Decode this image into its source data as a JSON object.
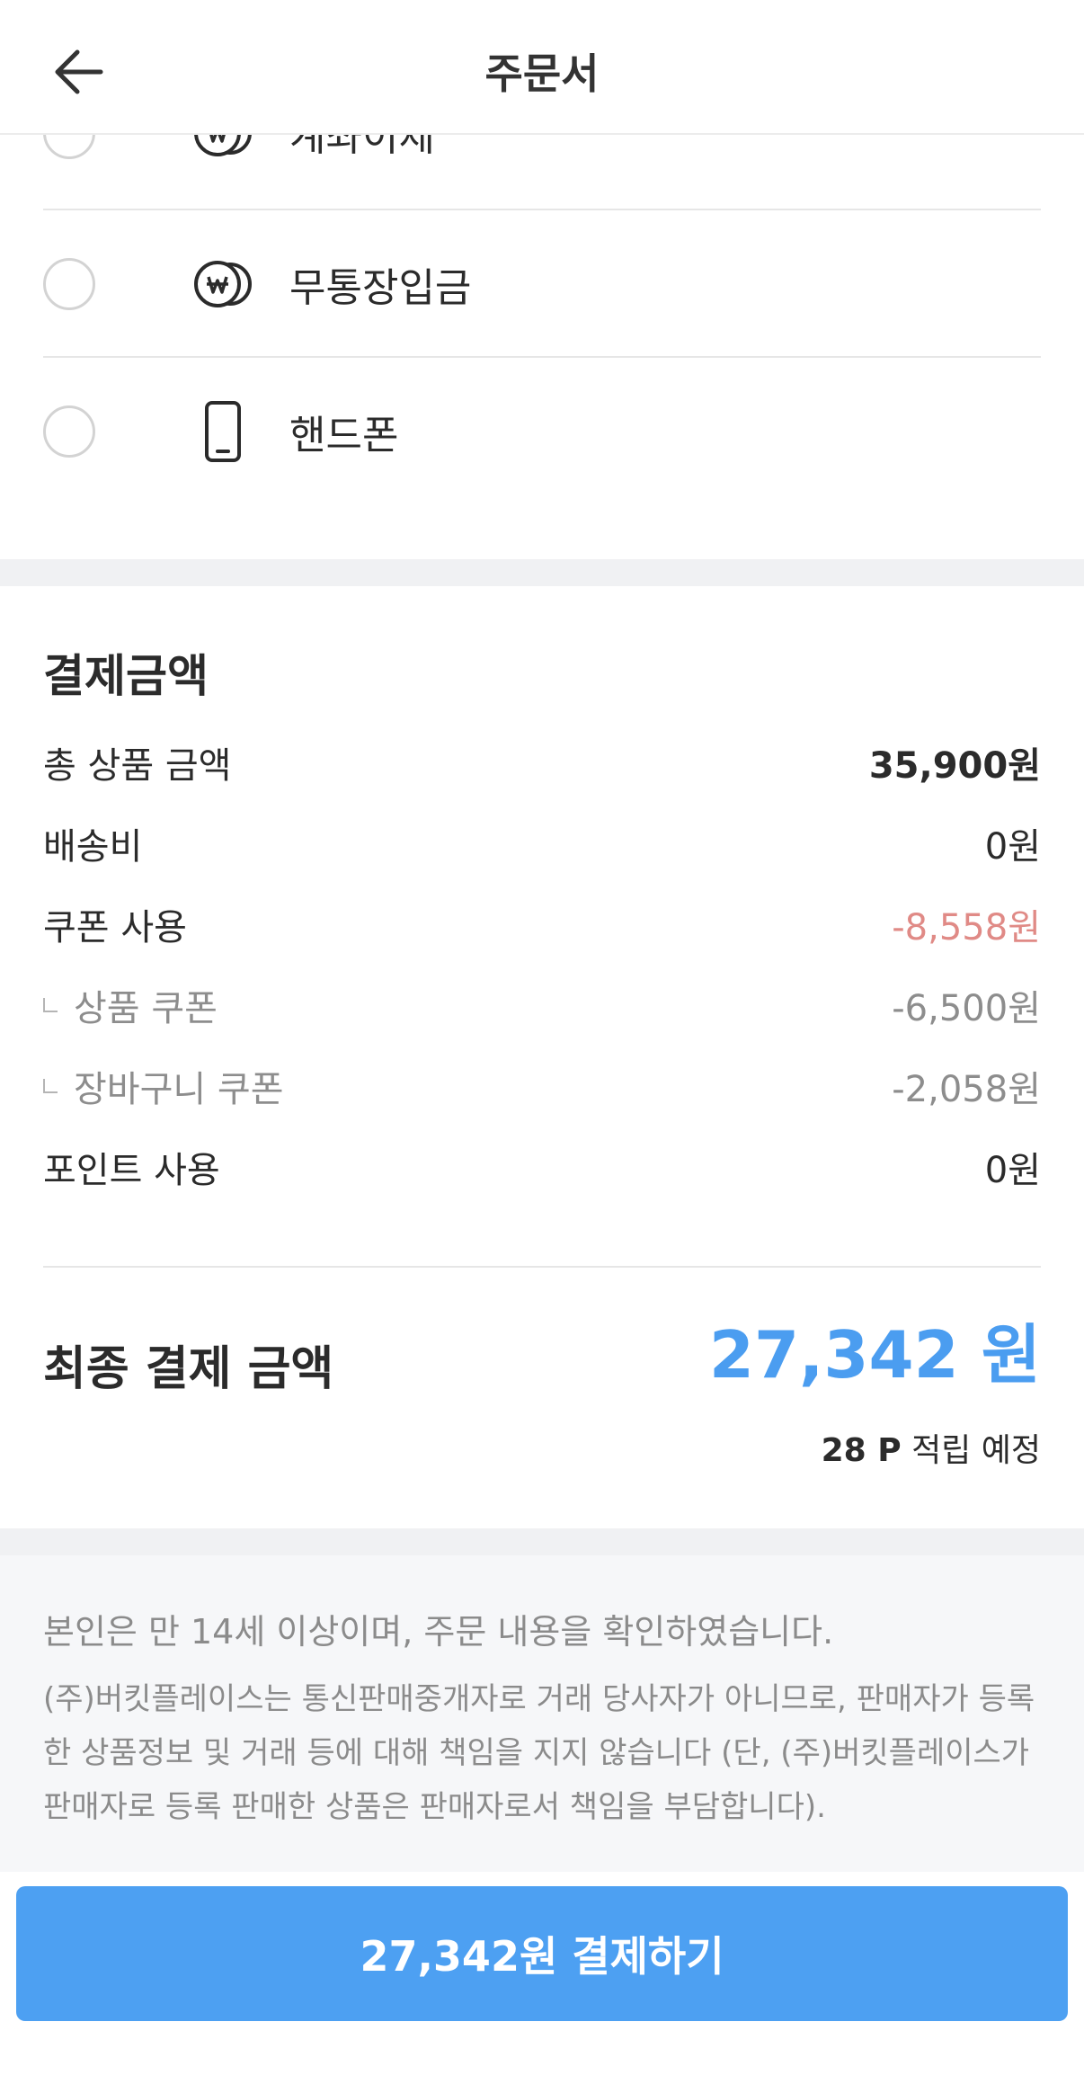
{
  "header": {
    "title": "주문서"
  },
  "payment_options": [
    {
      "label": "계좌이체",
      "icon": "won-coin-icon"
    },
    {
      "label": "무통장입금",
      "icon": "won-coin-icon"
    },
    {
      "label": "핸드폰",
      "icon": "smartphone-icon"
    }
  ],
  "amount": {
    "title": "결제금액",
    "rows": [
      {
        "label": "총 상품 금액",
        "value": "35,900원"
      },
      {
        "label": "배송비",
        "value": "0원"
      },
      {
        "label": "쿠폰 사용",
        "value": "-8,558원"
      },
      {
        "label": "상품 쿠폰",
        "value": "-6,500원"
      },
      {
        "label": "장바구니 쿠폰",
        "value": "-2,058원"
      },
      {
        "label": "포인트 사용",
        "value": "0원"
      }
    ],
    "final_label": "최종 결제 금액",
    "final_value": "27,342 원",
    "points_amount": "28 P",
    "points_text": "적립 예정"
  },
  "notice": {
    "main": "본인은 만 14세 이상이며, 주문 내용을 확인하였습니다.",
    "detail": "(주)버킷플레이스는 통신판매중개자로 거래 당사자가 아니므로, 판매자가 등록한 상품정보 및 거래 등에 대해 책임을 지지 않습니다 (단, (주)버킷플레이스가 판매자로 등록 판매한 상품은 판매자로서 책임을 부담합니다)."
  },
  "pay_button": {
    "label": "27,342원 결제하기"
  },
  "colors": {
    "accent": "#4da0f2",
    "final_amount": "#4b9df0",
    "coupon_discount": "#e08a86",
    "muted_text": "#8b8b8b"
  }
}
